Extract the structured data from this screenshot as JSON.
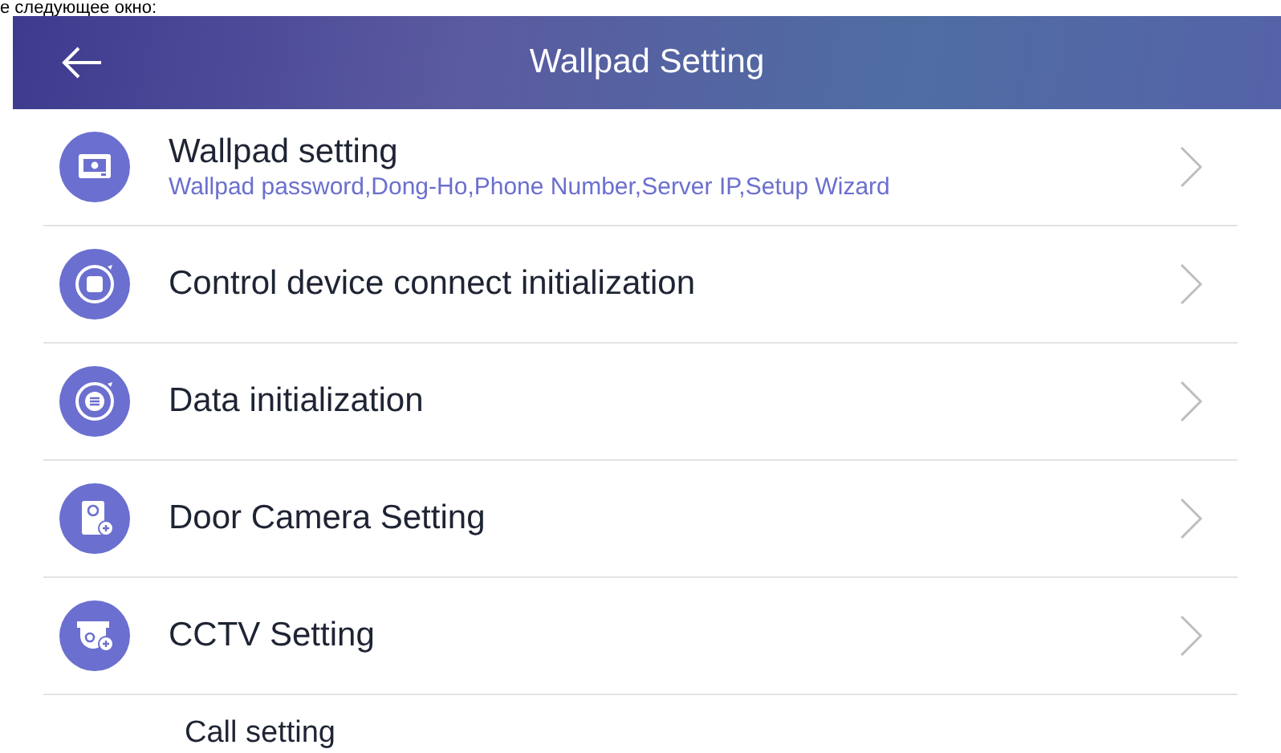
{
  "document_text": "е следующее окно:",
  "header": {
    "title": "Wallpad Setting"
  },
  "items": [
    {
      "title": "Wallpad setting",
      "subtitle": "Wallpad password,Dong-Ho,Phone Number,Server IP,Setup Wizard"
    },
    {
      "title": "Control device connect initialization"
    },
    {
      "title": "Data initialization"
    },
    {
      "title": "Door Camera Setting"
    },
    {
      "title": "CCTV Setting"
    },
    {
      "title": "Call setting"
    }
  ]
}
